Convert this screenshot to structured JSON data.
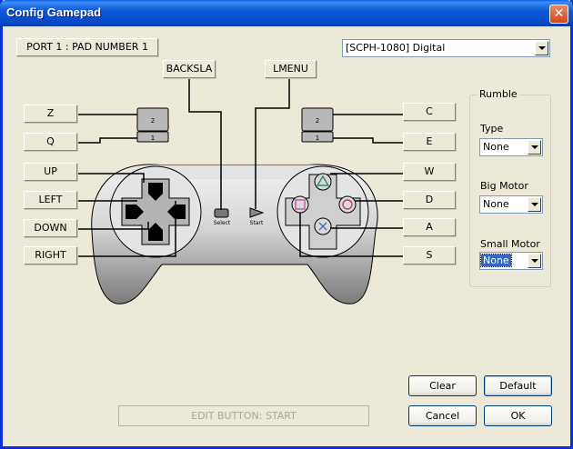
{
  "window": {
    "title": "Config Gamepad",
    "close_glyph": "✕"
  },
  "port_label": "PORT 1 : PAD NUMBER 1",
  "pad_type": {
    "selected": "[SCPH-1080] Digital"
  },
  "bindings": {
    "select": "BACKSLA",
    "start": "LMENU",
    "l2": "Z",
    "l1": "Q",
    "up": "UP",
    "left": "LEFT",
    "down": "DOWN",
    "right": "RIGHT",
    "r2": "C",
    "r1": "E",
    "triangle": "W",
    "circle": "D",
    "cross": "A",
    "square": "S"
  },
  "pad_labels": {
    "select": "Select",
    "start": "Start",
    "l2": "2",
    "l1": "1",
    "r2": "2",
    "r1": "1"
  },
  "rumble": {
    "title": "Rumble",
    "type_label": "Type",
    "type_value": "None",
    "big_motor_label": "Big Motor",
    "big_motor_value": "None",
    "small_motor_label": "Small Motor",
    "small_motor_value": "None"
  },
  "buttons": {
    "clear": "Clear",
    "default": "Default",
    "cancel": "Cancel",
    "ok": "OK"
  },
  "edit_status": "EDIT BUTTON: START",
  "colors": {
    "accent": "#316ac5",
    "title_bar": "#0648c8",
    "window_bg": "#ece9d8"
  }
}
